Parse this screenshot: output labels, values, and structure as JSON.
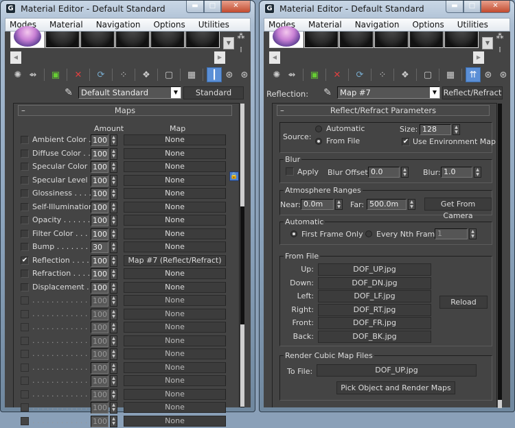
{
  "windows": [
    {
      "title": "Material Editor - Default Standard",
      "menu": [
        "Modes",
        "Material",
        "Navigation",
        "Options",
        "Utilities"
      ],
      "material_name": "Default Standard",
      "material_type": "Standard",
      "rollout_title": "Maps",
      "columns": {
        "amount": "Amount",
        "map": "Map"
      },
      "maps": [
        {
          "label": "Ambient Color . .",
          "checked": false,
          "amount": "100",
          "map": "None"
        },
        {
          "label": "Diffuse Color . . .",
          "checked": false,
          "amount": "100",
          "map": "None"
        },
        {
          "label": "Specular Color  .",
          "checked": false,
          "amount": "100",
          "map": "None"
        },
        {
          "label": "Specular Level  .",
          "checked": false,
          "amount": "100",
          "map": "None"
        },
        {
          "label": "Glossiness  . . . .",
          "checked": false,
          "amount": "100",
          "map": "None"
        },
        {
          "label": "Self-Illumination .",
          "checked": false,
          "amount": "100",
          "map": "None"
        },
        {
          "label": "Opacity . . . . . .",
          "checked": false,
          "amount": "100",
          "map": "None"
        },
        {
          "label": "Filter Color  . . . .",
          "checked": false,
          "amount": "100",
          "map": "None"
        },
        {
          "label": "Bump  . . . . . . .",
          "checked": false,
          "amount": "30",
          "map": "None"
        },
        {
          "label": "Reflection  . . . .",
          "checked": true,
          "amount": "100",
          "map": "Map #7  (Reflect/Refract)"
        },
        {
          "label": "Refraction  . . . .",
          "checked": false,
          "amount": "100",
          "map": "None"
        },
        {
          "label": "Displacement  . .",
          "checked": false,
          "amount": "100",
          "map": "None"
        },
        {
          "label": ". . . . . . . . . . . . .",
          "checked": false,
          "amount": "100",
          "map": "None",
          "dim": true
        },
        {
          "label": ". . . . . . . . . . . . .",
          "checked": false,
          "amount": "100",
          "map": "None",
          "dim": true
        },
        {
          "label": ". . . . . . . . . . . . .",
          "checked": false,
          "amount": "100",
          "map": "None",
          "dim": true
        },
        {
          "label": ". . . . . . . . . . . . .",
          "checked": false,
          "amount": "100",
          "map": "None",
          "dim": true
        },
        {
          "label": ". . . . . . . . . . . . .",
          "checked": false,
          "amount": "100",
          "map": "None",
          "dim": true
        },
        {
          "label": ". . . . . . . . . . . . .",
          "checked": false,
          "amount": "100",
          "map": "None",
          "dim": true
        },
        {
          "label": ". . . . . . . . . . . . .",
          "checked": false,
          "amount": "100",
          "map": "None",
          "dim": true
        },
        {
          "label": ". . . . . . . . . . . . .",
          "checked": false,
          "amount": "100",
          "map": "None",
          "dim": true
        },
        {
          "label": ". . . . . . . . . . . . .",
          "checked": false,
          "amount": "100",
          "map": "None",
          "dim": true
        },
        {
          "label": ". . . . . . . . . . . . .",
          "checked": false,
          "amount": "100",
          "map": "None",
          "dim": true
        }
      ]
    },
    {
      "title": "Material Editor - Default Standard",
      "menu": [
        "Modes",
        "Material",
        "Navigation",
        "Options",
        "Utilities"
      ],
      "slot_label": "Reflection:",
      "material_name": "Map #7",
      "material_type": "Reflect/Refract",
      "rollout_title": "Reflect/Refract Parameters",
      "source": {
        "label": "Source:",
        "options": [
          "Automatic",
          "From File"
        ],
        "selected": "From File",
        "size_label": "Size:",
        "size": "128",
        "use_env_label": "Use Environment Map",
        "use_env_checked": true
      },
      "blur": {
        "title": "Blur",
        "apply_label": "Apply",
        "apply_checked": false,
        "offset_label": "Blur Offset:",
        "offset": "0.0",
        "blur_label": "Blur:",
        "blur": "1.0"
      },
      "atmosphere": {
        "title": "Atmosphere Ranges",
        "near_label": "Near:",
        "near": "0.0m",
        "far_label": "Far:",
        "far": "500.0m",
        "camera_button": "Get From Camera"
      },
      "automatic": {
        "title": "Automatic",
        "options": [
          "First Frame Only",
          "Every Nth Frame:"
        ],
        "selected": "First Frame Only",
        "nth": "1"
      },
      "from_file": {
        "title": "From File",
        "files": [
          {
            "label": "Up:",
            "file": "DOF_UP.jpg"
          },
          {
            "label": "Down:",
            "file": "DOF_DN.jpg"
          },
          {
            "label": "Left:",
            "file": "DOF_LF.jpg"
          },
          {
            "label": "Right:",
            "file": "DOF_RT.jpg"
          },
          {
            "label": "Front:",
            "file": "DOF_FR.jpg"
          },
          {
            "label": "Back:",
            "file": "DOF_BK.jpg"
          }
        ],
        "reload_button": "Reload"
      },
      "render_cubic": {
        "title": "Render Cubic Map Files",
        "to_file_label": "To File:",
        "to_file": "DOF_UP.jpg",
        "pick_button": "Pick Object and Render Maps"
      }
    }
  ],
  "icons": {
    "logo": "3ds-max-logo",
    "toolbar": [
      "get-material-icon",
      "put-to-scene-icon",
      "assign-material-icon",
      "reset-map-icon",
      "copy-material-icon",
      "make-unique-icon",
      "put-to-library-icon",
      "material-id-icon",
      "show-map-icon",
      "show-end-result-icon",
      "go-to-parent-icon",
      "go-forward-sibling-icon"
    ]
  }
}
